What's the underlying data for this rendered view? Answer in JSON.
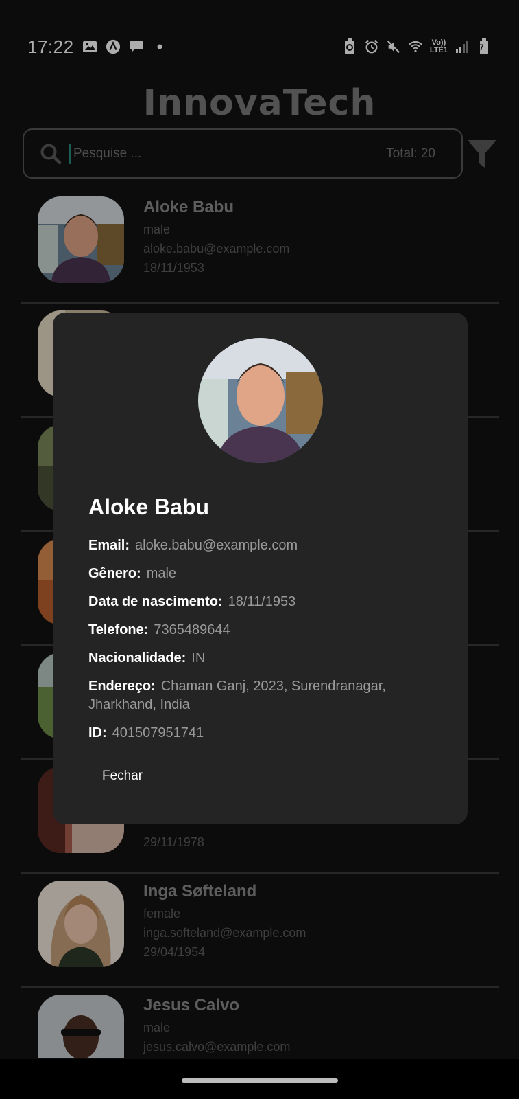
{
  "status_bar": {
    "time": "17:22",
    "left_icons": [
      "image-icon",
      "a-circle-icon",
      "message-icon",
      "dot-icon"
    ],
    "right_icons": [
      "battery-saver-icon",
      "alarm-icon",
      "mute-icon",
      "wifi-icon",
      "volte-icon",
      "signal-icon",
      "battery-icon"
    ],
    "volte_label_top": "Vo))",
    "volte_label_bottom": "LTE1",
    "battery_level": "7"
  },
  "app": {
    "title": "InnovaTech"
  },
  "search": {
    "placeholder": "Pesquise ...",
    "total_label": "Total: 20"
  },
  "users": [
    {
      "name": "Aloke Babu",
      "gender": "male",
      "email": "aloke.babu@example.com",
      "dob": "18/11/1953",
      "photo_tone": "#6b8296"
    },
    {
      "name": "",
      "gender": "",
      "email": "",
      "dob": "",
      "photo_tone": "#c9b89a"
    },
    {
      "name": "",
      "gender": "",
      "email": "",
      "dob": "",
      "photo_tone": "#7b8a5a"
    },
    {
      "name": "",
      "gender": "",
      "email": "",
      "dob": "",
      "photo_tone": "#b8602e"
    },
    {
      "name": "",
      "gender": "",
      "email": "",
      "dob": "",
      "photo_tone": "#6f8f4a"
    },
    {
      "name": "",
      "gender": "",
      "email": "",
      "dob": "29/11/1978",
      "photo_tone": "#a85a4a"
    },
    {
      "name": "Inga Søfteland",
      "gender": "female",
      "email": "inga.softeland@example.com",
      "dob": "29/04/1954",
      "photo_tone": "#c4a07a"
    },
    {
      "name": "Jesus Calvo",
      "gender": "male",
      "email": "jesus.calvo@example.com",
      "dob": "",
      "photo_tone": "#7e8a95"
    }
  ],
  "modal": {
    "name": "Aloke Babu",
    "fields": [
      {
        "label": "Email:",
        "value": "aloke.babu@example.com"
      },
      {
        "label": "Gênero:",
        "value": "male"
      },
      {
        "label": "Data de nascimento:",
        "value": "18/11/1953"
      },
      {
        "label": "Telefone:",
        "value": "7365489644"
      },
      {
        "label": "Nacionalidade:",
        "value": "IN"
      },
      {
        "label": "Endereço:",
        "value": "Chaman Ganj, 2023, Surendranagar, Jharkhand, India"
      },
      {
        "label": "ID:",
        "value": "401507951741"
      }
    ],
    "close_label": "Fechar"
  },
  "colors": {
    "background": "#121212",
    "modal": "#242424",
    "accent_cursor": "#2a8a7e"
  }
}
